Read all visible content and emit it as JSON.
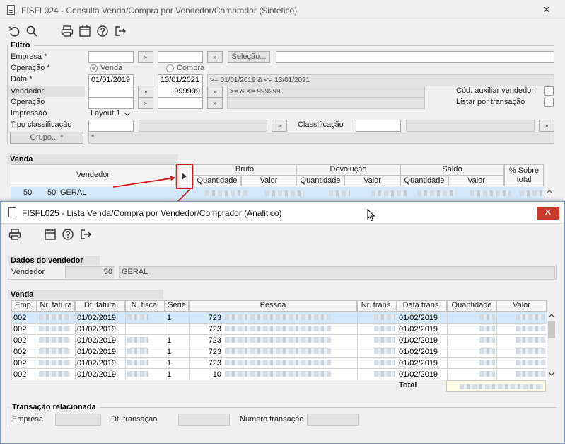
{
  "window1": {
    "title": "FISFL024 - Consulta Venda/Compra por Vendedor/Comprador (Sintético)",
    "close_glyph": "✕",
    "toolbar_icons": [
      "undo-icon",
      "search-icon",
      "print-icon",
      "calendar-icon",
      "help-icon",
      "exit-icon"
    ],
    "filtro": {
      "title": "Filtro",
      "empresa_label": "Empresa *",
      "lookup_glyph": "»",
      "selecao_label": "Seleção...",
      "operacao_label": "Operação *",
      "venda_label": "Venda",
      "compra_label": "Compra",
      "data_label": "Data *",
      "data_inicio": "01/01/2019",
      "data_fim": "13/01/2021",
      "data_expr": ">=  01/01/2019  &  <=  13/01/2021",
      "vendedor_label": "Vendedor",
      "vendedor_fim": "999999",
      "vendedor_expr": ">=   &  <=  999999",
      "operacao2_label": "Operação",
      "impressao_label": "Impressão",
      "impressao_value": "Layout 1",
      "tipo_class_label": "Tipo classificação",
      "classificacao_label": "Classificação",
      "grupo_label": "Grupo... *",
      "grupo_value": "*",
      "cod_aux_label": "Cód. auxiliar vendedor",
      "listar_label": "Listar por transação"
    },
    "venda": {
      "title": "Venda",
      "col_vendedor": "Vendedor",
      "col_bruto": "Bruto",
      "col_devolucao": "Devolução",
      "col_saldo": "Saldo",
      "col_sobre_total": "% Sobre total",
      "col_quantidade": "Quantidade",
      "col_valor": "Valor",
      "row": {
        "emp": "50",
        "code": "50",
        "name": "GERAL"
      }
    }
  },
  "window2": {
    "title": "FISFL025 - Lista Venda/Compra por Vendedor/Comprador (Analitico)",
    "close_glyph": "✕",
    "dados": {
      "title": "Dados do vendedor",
      "vendedor_label": "Vendedor",
      "vendedor_code": "50",
      "vendedor_name": "GERAL"
    },
    "venda": {
      "title": "Venda",
      "columns": [
        "Emp.",
        "Nr. fatura",
        "Dt. fatura",
        "N. fiscal",
        "Série",
        "Pessoa",
        "Nr. trans.",
        "Data trans.",
        "Quantidade",
        "Valor"
      ],
      "rows": [
        {
          "emp": "002",
          "dt": "01/02/2019",
          "serie": "1",
          "pessoa": "723",
          "data": "01/02/2019"
        },
        {
          "emp": "002",
          "dt": "01/02/2019",
          "serie": "",
          "pessoa": "723",
          "data": "01/02/2019"
        },
        {
          "emp": "002",
          "dt": "01/02/2019",
          "serie": "1",
          "pessoa": "723",
          "data": "01/02/2019"
        },
        {
          "emp": "002",
          "dt": "01/02/2019",
          "serie": "1",
          "pessoa": "723",
          "data": "01/02/2019"
        },
        {
          "emp": "002",
          "dt": "01/02/2019",
          "serie": "1",
          "pessoa": "723",
          "data": "01/02/2019"
        },
        {
          "emp": "002",
          "dt": "01/02/2019",
          "serie": "1",
          "pessoa": "10",
          "data": "01/02/2019"
        }
      ],
      "total_label": "Total"
    },
    "transacao": {
      "title": "Transação relacionada",
      "empresa_label": "Empresa",
      "dt_label": "Dt. transação",
      "numero_label": "Número transação"
    }
  },
  "colors": {
    "accent": "#d01c1c",
    "selection": "#d3e8fa",
    "close_red": "#c8392b"
  }
}
